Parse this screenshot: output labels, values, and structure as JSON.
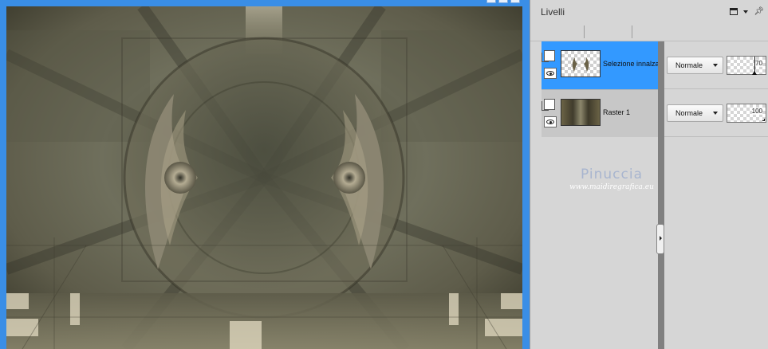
{
  "panel": {
    "title": "Livelli"
  },
  "layers": [
    {
      "name": "Selezione innalzata",
      "blend_mode": "Normale",
      "opacity": "70",
      "opacity_fraction": 0.7,
      "selected": true
    },
    {
      "name": "Raster 1",
      "blend_mode": "Normale",
      "opacity": "100",
      "opacity_fraction": 1.0,
      "selected": false
    }
  ],
  "watermark": {
    "name": "Pinuccia",
    "url": "www.maidiregrafica.eu"
  },
  "colors": {
    "canvas_border": "#3a8ee6",
    "selected_layer": "#3399ff",
    "panel_bg": "#d6d6d6"
  }
}
